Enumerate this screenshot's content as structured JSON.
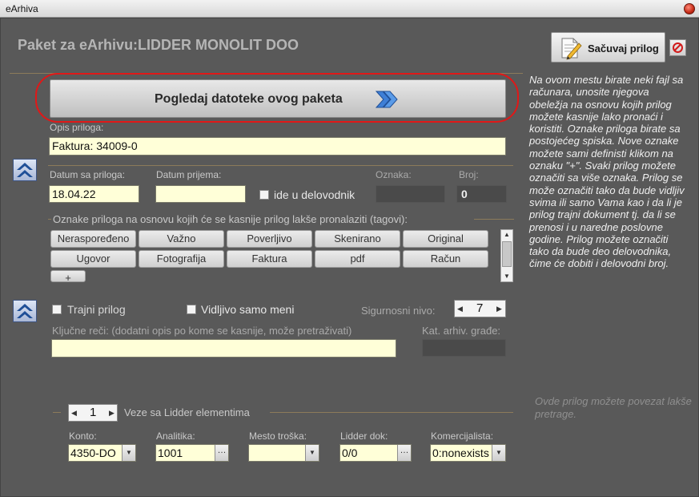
{
  "window": {
    "title": "eArhiva"
  },
  "header": {
    "title": "Paket za eArhivu:LIDDER MONOLIT DOO"
  },
  "toolbar": {
    "save_label": "Sačuvaj prilog",
    "save_icon": "edit-document-icon",
    "cancel_icon": "cancel-icon"
  },
  "files_button": {
    "label": "Pogledaj datoteke ovog paketa"
  },
  "description": {
    "label": "Opis priloga:",
    "value": "Faktura: 34009-0"
  },
  "dates": {
    "document_date_label": "Datum sa priloga:",
    "document_date_value": "18.04.22",
    "received_date_label": "Datum prijema:",
    "received_date_value": "",
    "delovodnik_label": "ide u delovodnik",
    "mark_label": "Oznaka:",
    "mark_value": "",
    "number_label": "Broj:",
    "number_value": "0"
  },
  "tags": {
    "legend": "Oznake priloga na osnovu kojih će se kasnije prilog lakše pronalaziti (tagovi):",
    "items": [
      "Neraspoređeno",
      "Važno",
      "Poverljivo",
      "Skenirano",
      "Original",
      "Ugovor",
      "Fotografija",
      "Faktura",
      "pdf",
      "Račun"
    ],
    "add_label": "+"
  },
  "options": {
    "permanent_label": "Trajni prilog",
    "only_me_label": "Vidljivo samo meni",
    "security_label": "Sigurnosni nivo:",
    "security_value": "7"
  },
  "keywords": {
    "label": "Ključne reči: (dodatni opis po kome se kasnije, može pretraživati)",
    "value": "",
    "category_label": "Kat. arhiv. građe:",
    "category_value": ""
  },
  "links": {
    "counter": "1",
    "legend": "Veze sa Lidder elementima",
    "konto_label": "Konto:",
    "konto_value": "4350-DO",
    "analitika_label": "Analitika:",
    "analitika_value": "1001",
    "mesto_label": "Mesto troška:",
    "mesto_value": "",
    "lidder_label": "Lidder dok:",
    "lidder_value": "0/0",
    "komercijalista_label": "Komercijalista:",
    "komercijalista_value": "0:nonexists"
  },
  "help": {
    "main": "Na ovom mestu birate neki fajl sa računara, unosite njegova obeležja na osnovu kojih prilog možete kasnije lako pronaći i koristiti. Oznake priloga birate sa postojećeg spiska. Nove oznake možete sami definisti klikom na oznaku \"+\". Svaki prilog možete označiti sa više oznaka. Prilog se može označiti tako da bude vidljiv svima ili samo Vama  kao i da li je prilog trajni dokument tj. da li se prenosi i u naredne poslovne godine. Prilog možete označiti tako da bude deo delovodnika, čime će dobiti i delovodni broj.",
    "links": "Ovde prilog možete povezat lakše pretrage."
  },
  "colors": {
    "background": "#595959",
    "field": "#ffffd8",
    "accent_line": "#8c7b5a",
    "highlight_ring": "#e01818"
  }
}
